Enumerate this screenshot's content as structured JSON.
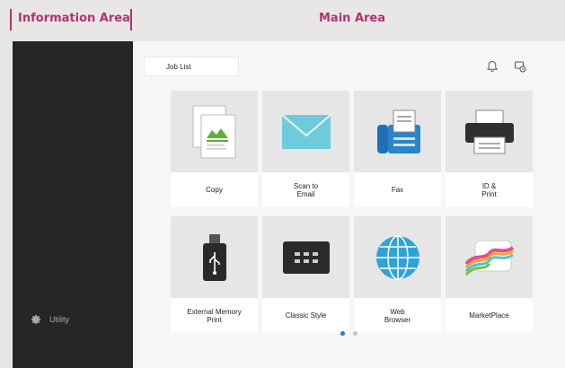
{
  "header": {
    "info_area": "Information Area",
    "main_area": "Main Area"
  },
  "sidebar": {
    "utility_label": "Utility",
    "utility_icon": "gear-icon"
  },
  "toolbar": {
    "job_list_label": "Job List",
    "bell_icon": "bell-icon",
    "message_icon": "message-icon"
  },
  "apps": [
    {
      "label": "Copy",
      "icon": "copy-icon"
    },
    {
      "label": "Scan to\nEmail",
      "icon": "envelope-icon"
    },
    {
      "label": "Fax",
      "icon": "fax-icon"
    },
    {
      "label": "ID &\nPrint",
      "icon": "printer-icon"
    },
    {
      "label": "External Memory\nPrint",
      "icon": "usb-icon"
    },
    {
      "label": "Classic Style",
      "icon": "classic-style-icon"
    },
    {
      "label": "Web\nBrowser",
      "icon": "globe-icon"
    },
    {
      "label": "MarketPlace",
      "icon": "marketplace-icon"
    }
  ],
  "pagination": {
    "pages": 2,
    "current": 1
  },
  "colors": {
    "accent": "#b5316d",
    "sidebar": "#262626",
    "active_dot": "#1f7fd1"
  }
}
